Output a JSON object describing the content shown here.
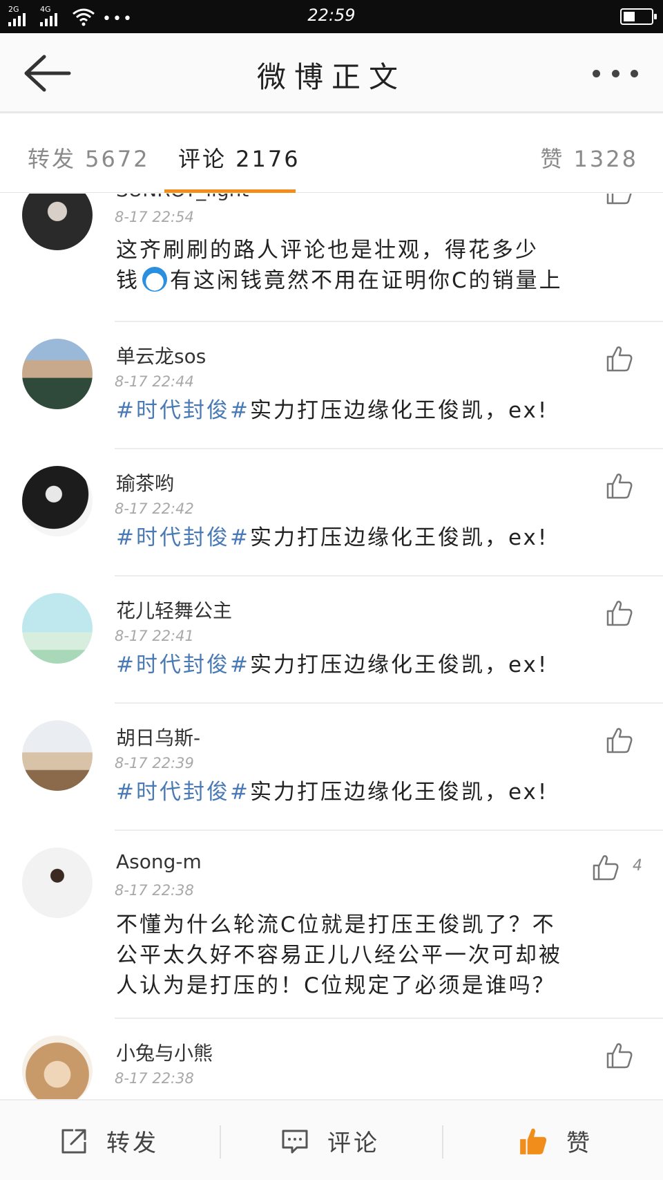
{
  "status_bar": {
    "time": "22:59",
    "sim1": "2G",
    "sim2": "4G",
    "more": "•••"
  },
  "nav": {
    "title": "微博正文"
  },
  "tabs": {
    "repost": "转发 5672",
    "comment": "评论 2176",
    "like": "赞 1328"
  },
  "comments": [
    {
      "name": "SUNROY_light",
      "time": "8-17 22:54",
      "hashtag": "",
      "text_line1": "这齐刷刷的路人评论也是壮观，得花多少",
      "text_line2": "钱",
      "emoji": "doraemon-emoji",
      "text_line2b": "有这闲钱竟然不用在证明你C的销量上",
      "likes": ""
    },
    {
      "name": "单云龙sos",
      "time": "8-17 22:44",
      "hashtag": "#时代封俊#",
      "text": "实力打压边缘化王俊凯，ex!",
      "likes": ""
    },
    {
      "name": "瑜茶哟",
      "time": "8-17 22:42",
      "hashtag": "#时代封俊#",
      "text": "实力打压边缘化王俊凯，ex!",
      "likes": ""
    },
    {
      "name": "花儿轻舞公主",
      "time": "8-17 22:41",
      "hashtag": "#时代封俊#",
      "text": "实力打压边缘化王俊凯，ex!",
      "likes": ""
    },
    {
      "name": "胡日乌斯-",
      "time": "8-17 22:39",
      "hashtag": "#时代封俊#",
      "text": "实力打压边缘化王俊凯，ex!",
      "likes": ""
    },
    {
      "name": "Asong-m",
      "time": "8-17 22:38",
      "text_line1": "不懂为什么轮流C位就是打压王俊凯了？不",
      "text_line2": "公平太久好不容易正儿八经公平一次可却被",
      "text_line3": "人认为是打压的！C位规定了必须是谁吗？",
      "likes": "4"
    },
    {
      "name": "小兔与小熊",
      "time": "8-17 22:38",
      "likes": ""
    }
  ],
  "toolbar": {
    "repost": "转发",
    "comment": "评论",
    "like": "赞"
  },
  "colors": {
    "accent": "#f08d1b",
    "hashtag": "#4a7ab5",
    "status_bar": "#0d0d0d"
  }
}
